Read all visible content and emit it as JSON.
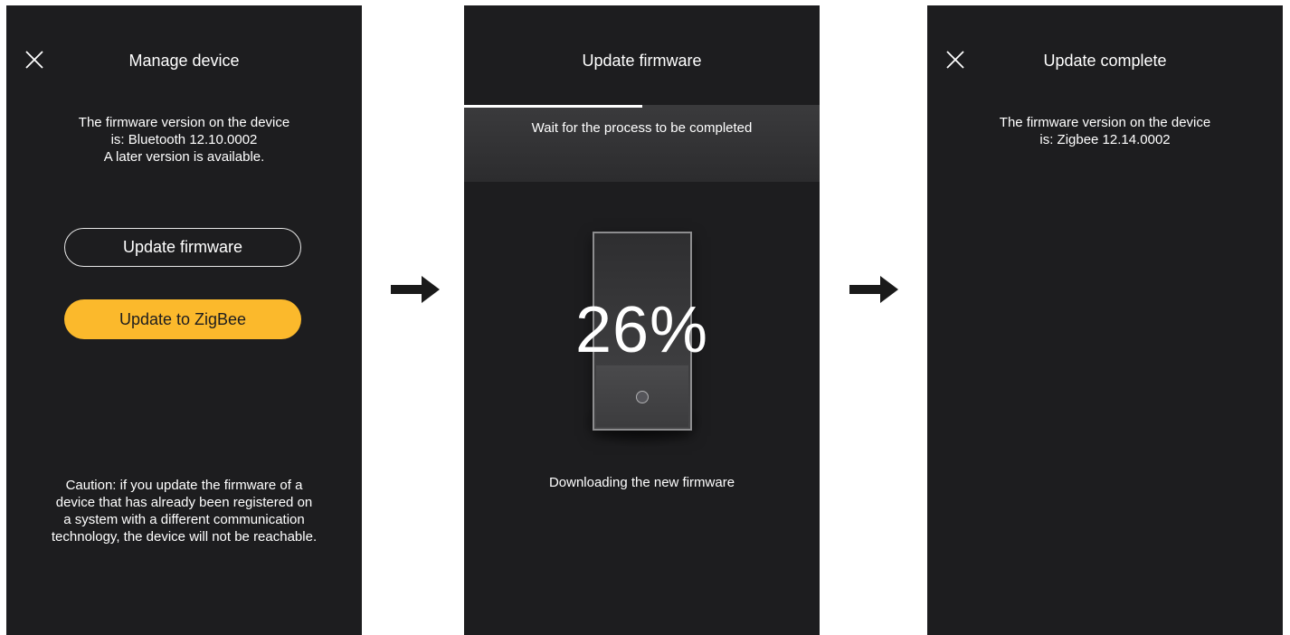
{
  "colors": {
    "screen_background": "#1d1d1f",
    "accent_yellow": "#fbb92c",
    "text": "#ffffff",
    "arrow": "#1a1a1a"
  },
  "screens": [
    {
      "title": "Manage device",
      "close_icon": "close-icon",
      "firmware_line1": "The firmware version on the device",
      "firmware_line2": "is: Bluetooth 12.10.0002",
      "firmware_line3": "A later version is available.",
      "update_firmware_label": "Update firmware",
      "update_zigbee_label": "Update to ZigBee",
      "caution_line1": "Caution: if you update the firmware of a",
      "caution_line2": "device that has already been registered on",
      "caution_line3": "a system with a different communication",
      "caution_line4": "technology, the device will not be reachable."
    },
    {
      "title": "Update firmware",
      "progress_fraction": 0.5,
      "banner_text": "Wait for the process to be completed",
      "percent_label": "26%",
      "status_text": "Downloading the new firmware"
    },
    {
      "title": "Update complete",
      "close_icon": "close-icon",
      "firmware_line1": "The firmware version on the device",
      "firmware_line2": "is: Zigbee 12.14.0002"
    }
  ],
  "flow_arrows": [
    "arrow-right-icon",
    "arrow-right-icon"
  ]
}
